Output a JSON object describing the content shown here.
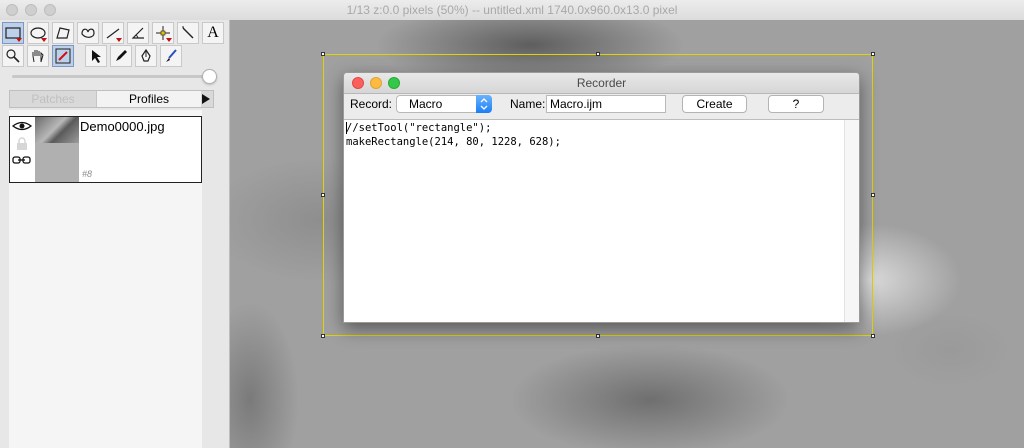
{
  "window": {
    "title": "1/13  z:0.0 pixels   (50%) -- untitled.xml  1740.0x960.0x13.0 pixel"
  },
  "toolbar": {
    "tools": [
      {
        "name": "rectangle-tool",
        "icon": "rectangle-icon",
        "selected": true
      },
      {
        "name": "ellipse-tool",
        "icon": "ellipse-icon"
      },
      {
        "name": "polygon-tool",
        "icon": "polygon-icon"
      },
      {
        "name": "freehand-tool",
        "icon": "freehand-icon"
      },
      {
        "name": "line-tool",
        "icon": "line-icon"
      },
      {
        "name": "angle-tool",
        "icon": "angle-icon"
      },
      {
        "name": "point-tool",
        "icon": "point-icon"
      },
      {
        "name": "wand-tool",
        "icon": "wand-icon"
      },
      {
        "name": "text-tool",
        "icon": "text-icon",
        "label": "A"
      },
      {
        "name": "magnifier-tool",
        "icon": "magnifier-icon"
      },
      {
        "name": "hand-tool",
        "icon": "hand-icon"
      },
      {
        "name": "dropper-tool",
        "icon": "dropper-icon",
        "selected": true
      },
      {
        "name": "select-arrow-tool",
        "icon": "arrow-icon"
      },
      {
        "name": "pencil-tool",
        "icon": "pencil-icon"
      },
      {
        "name": "pen-tool",
        "icon": "pen-icon"
      },
      {
        "name": "brush-tool",
        "icon": "brush-icon"
      }
    ]
  },
  "panel": {
    "tabs": [
      {
        "label": "Patches",
        "active": false
      },
      {
        "label": "Profiles",
        "active": true
      }
    ],
    "layers": [
      {
        "name": "Demo0000.jpg",
        "id": "#8"
      }
    ]
  },
  "recorder": {
    "title": "Recorder",
    "record_label": "Record:",
    "record_value": "Macro",
    "name_label": "Name:",
    "name_value": "Macro.ijm",
    "create_label": "Create",
    "help_label": "?",
    "code_lines": [
      "//setTool(\"rectangle\");",
      "makeRectangle(214, 80, 1228, 628);"
    ]
  },
  "colors": {
    "selection": "#e0d400",
    "select_accent": "#1a7ff6",
    "close": "#fc605c",
    "minimize": "#fdbc40",
    "zoom": "#34c84a"
  }
}
